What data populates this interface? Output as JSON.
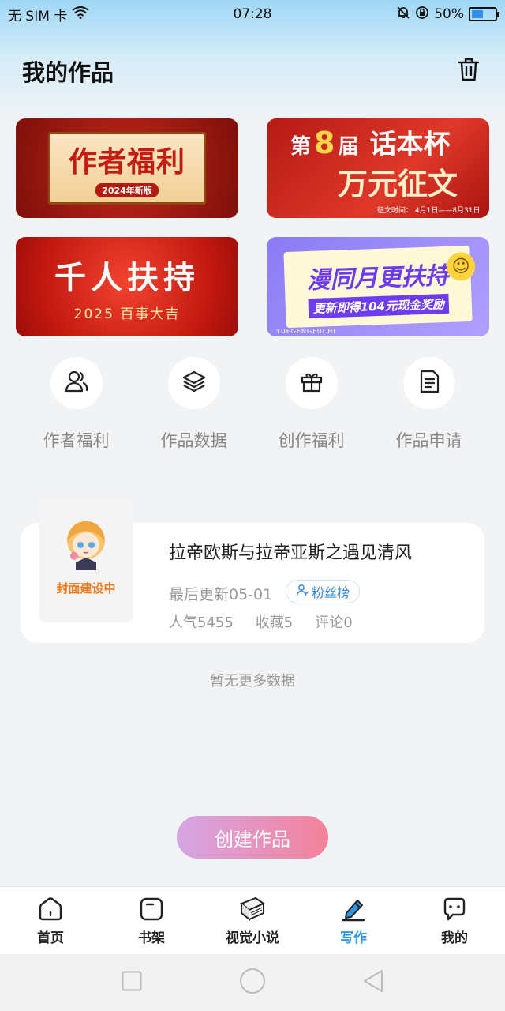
{
  "status_bar": {
    "carrier": "无 SIM 卡",
    "time": "07:28",
    "battery": "50%",
    "battery_level": 0.5
  },
  "header": {
    "title": "我的作品",
    "trash_icon": "trash-icon"
  },
  "banners": [
    {
      "main": "作者福利",
      "sub": "2024年新版"
    },
    {
      "prefix": "第",
      "number": "8",
      "suffix": "届",
      "title": "话本杯",
      "main": "万元征文",
      "sub": "征文时间：  4月1日——8月31日"
    },
    {
      "main": "千人扶持",
      "sub": "2025 百事大吉"
    },
    {
      "main": "漫同月更扶持",
      "sub": "更新即得104元现金奖励",
      "tag": "YUEGENGFUCHI"
    }
  ],
  "quick_actions": [
    {
      "label": "作者福利",
      "icon": "author-users-icon"
    },
    {
      "label": "作品数据",
      "icon": "layers-icon"
    },
    {
      "label": "创作福利",
      "icon": "gift-icon"
    },
    {
      "label": "作品申请",
      "icon": "document-icon"
    }
  ],
  "work": {
    "cover_label": "封面建设中",
    "title": "拉帝欧斯与拉帝亚斯之遇见清风",
    "last_updated": "最后更新05-01",
    "fans_button": "粉丝榜",
    "popularity": "人气5455",
    "favorites": "收藏5",
    "comments": "评论0"
  },
  "no_more_text": "暂无更多数据",
  "create_button": "创建作品",
  "bottom_nav": [
    {
      "label": "首页",
      "icon": "home-icon"
    },
    {
      "label": "书架",
      "icon": "bookshelf-icon"
    },
    {
      "label": "视觉小说",
      "icon": "book-icon"
    },
    {
      "label": "写作",
      "icon": "pen-icon",
      "active": true
    },
    {
      "label": "我的",
      "icon": "chat-icon"
    }
  ],
  "colors": {
    "accent": "#2f97e8",
    "create_gradient_start": "#d6a6e6",
    "create_gradient_end": "#f4829a",
    "cover_label": "#f07a1a"
  }
}
